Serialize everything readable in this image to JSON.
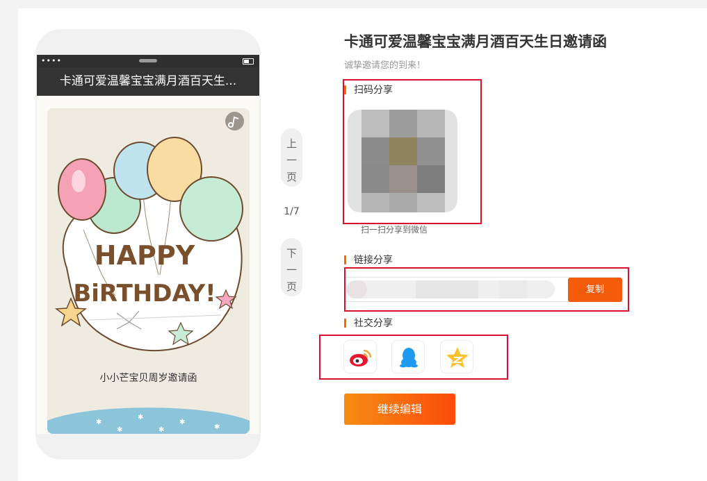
{
  "phone": {
    "title": "卡通可爱温馨宝宝满月酒百天生...",
    "status_dots": "••••",
    "card_headline_1": "HAPPY",
    "card_headline_2": "BiRTHDAY!",
    "card_caption": "小小芒宝贝周岁邀请函"
  },
  "pager": {
    "prev_label": "上一页",
    "current": 1,
    "total": 7,
    "text": "1/7",
    "next_label": "下一页"
  },
  "share": {
    "title": "卡通可爱温馨宝宝满月酒百天生日邀请函",
    "subtitle": "诚挚邀请您的到来！",
    "qr_section_label": "扫码分享",
    "qr_caption": "扫一扫分享到微信",
    "link_section_label": "链接分享",
    "copy_label": "复制",
    "social_section_label": "社交分享",
    "social_icons": [
      "weibo-icon",
      "qq-icon",
      "qzone-icon"
    ],
    "edit_label": "继续编辑"
  },
  "colors": {
    "accent": "#f45b0b",
    "highlight_box": "#d9112f",
    "section_bar": "#ff6a00"
  }
}
